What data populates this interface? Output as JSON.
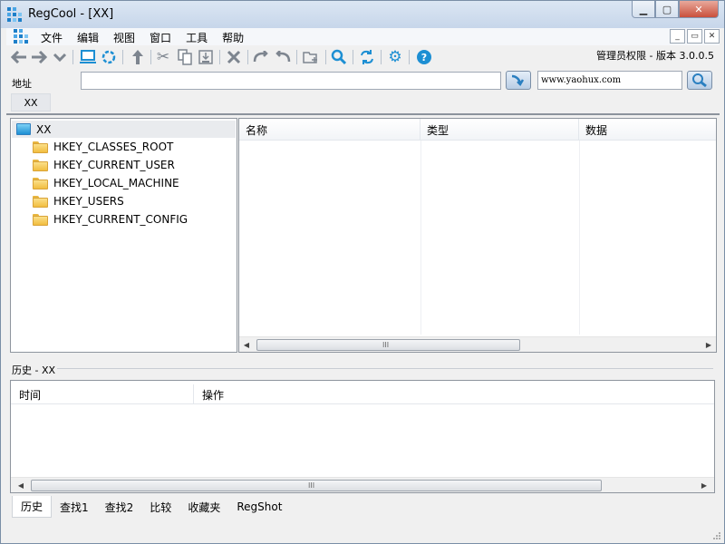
{
  "window": {
    "title": "RegCool - [XX]",
    "controls": {
      "minimize": "▁",
      "maximize": "▢",
      "close": "✕"
    }
  },
  "menubar": {
    "items": [
      "文件",
      "编辑",
      "视图",
      "窗口",
      "工具",
      "帮助"
    ],
    "mdi_controls": {
      "minimize": "_",
      "restore": "▭",
      "close": "✕"
    }
  },
  "toolbar": {
    "version": "管理员权限 - 版本 3.0.0.5",
    "icons": [
      "back-arrow-icon",
      "forward-arrow-icon",
      "dropdown-chevron-icon",
      "computer-icon",
      "network-icon",
      "up-arrow-icon",
      "cut-icon",
      "copy-icon",
      "export-icon",
      "delete-icon",
      "redo-icon",
      "undo-icon",
      "new-folder-icon",
      "search-icon",
      "refresh-icon",
      "settings-icon",
      "help-icon"
    ]
  },
  "address": {
    "label": "地址",
    "value": "",
    "search_value": "www.yaohux.com"
  },
  "doc_tab": {
    "label": "XX"
  },
  "tree": {
    "root": "XX",
    "items": [
      {
        "label": "HKEY_CLASSES_ROOT"
      },
      {
        "label": "HKEY_CURRENT_USER"
      },
      {
        "label": "HKEY_LOCAL_MACHINE"
      },
      {
        "label": "HKEY_USERS"
      },
      {
        "label": "HKEY_CURRENT_CONFIG"
      }
    ]
  },
  "list": {
    "columns": [
      "名称",
      "类型",
      "数据"
    ],
    "rows": []
  },
  "history": {
    "label": "历史 - XX",
    "columns": [
      "时间",
      "操作"
    ],
    "rows": []
  },
  "bottom_tabs": [
    "历史",
    "查找1",
    "查找2",
    "比较",
    "收藏夹",
    "RegShot"
  ],
  "scrollbar": {
    "grip": "III",
    "left": "◀",
    "right": "▶"
  },
  "colors": {
    "titlebar": "#c7d6ea",
    "accent_blue": "#1d8fd3",
    "folder_yellow": "#f1bd3f",
    "close_red": "#c9503c"
  }
}
